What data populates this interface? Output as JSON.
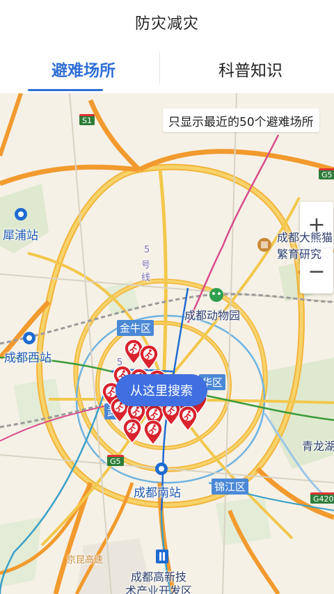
{
  "header": {
    "title": "防灾减灾"
  },
  "tabs": [
    {
      "label": "避难场所",
      "active": true
    },
    {
      "label": "科普知识",
      "active": false
    }
  ],
  "map": {
    "notice": "只显示最近的50个避难场所",
    "zoom_in": "+",
    "zoom_out": "−",
    "search_here": "从这里搜索",
    "labels": {
      "xipu": "犀浦站",
      "chengdu_west": "成都西站",
      "zoo": "成都动物园",
      "jinniu": "金牛区",
      "chenghua": "华区",
      "chengdu_south": "成都南站",
      "jinjiang": "锦江区",
      "qinglong": "青龙湖",
      "gaoxin_1": "成都高新技",
      "gaoxin_2": "术产业开发区",
      "daxiongmao_1": "成都大熊猫",
      "daxiongmao_2": "繁育研究",
      "line5_a": "5",
      "line5_b": "号",
      "line5_c": "线",
      "line5_d": "5",
      "wu": "武",
      "jingkun": "京昆高速"
    },
    "shields": {
      "s1": "S1",
      "g5_a": "G5",
      "g5_b": "G5",
      "g4202": "G420"
    },
    "colors": {
      "accent": "#2f6fd6",
      "marker": "#d9232e",
      "bubble": "#3f6fe0"
    }
  }
}
